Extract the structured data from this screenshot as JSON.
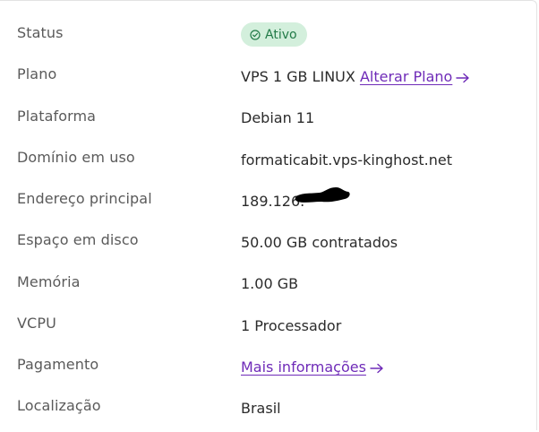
{
  "status": {
    "label": "Status",
    "badge_text": "Ativo",
    "badge_icon": "check-circle-icon",
    "badge_color": "#217a47",
    "badge_bg": "#d3efdc"
  },
  "plano": {
    "label": "Plano",
    "value": "VPS 1 GB LINUX",
    "link_text": "Alterar Plano",
    "link_icon": "arrow-right-icon"
  },
  "plataforma": {
    "label": "Plataforma",
    "value": "Debian 11"
  },
  "dominio": {
    "label": "Domínio em uso",
    "value": "formaticabit.vps-kinghost.net"
  },
  "endereco": {
    "label": "Endereço principal",
    "value": "189.126."
  },
  "espaco": {
    "label": "Espaço em disco",
    "value": "50.00 GB contratados"
  },
  "memoria": {
    "label": "Memória",
    "value": "1.00 GB"
  },
  "vcpu": {
    "label": "VCPU",
    "value": "1 Processador"
  },
  "pagamento": {
    "label": "Pagamento",
    "link_text": "Mais informações",
    "link_icon": "arrow-right-icon"
  },
  "localizacao": {
    "label": "Localização",
    "value": "Brasil"
  },
  "colors": {
    "link": "#6f2bb8",
    "label": "#5a5a5a",
    "value": "#2b2b2b"
  }
}
